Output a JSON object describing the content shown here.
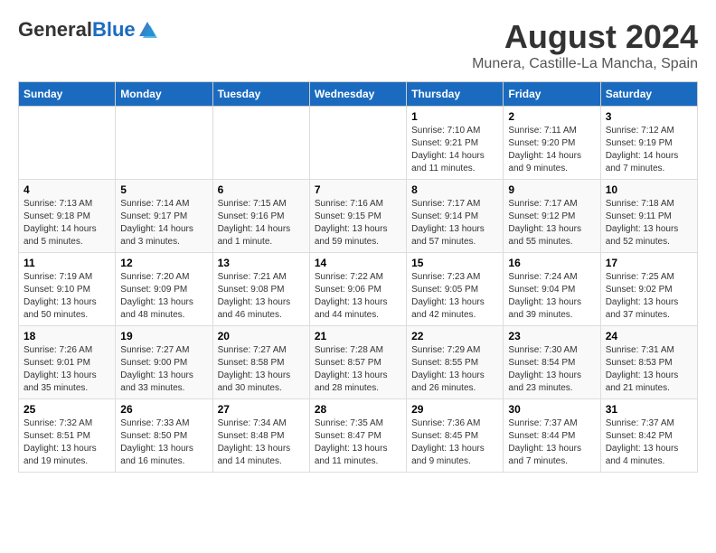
{
  "header": {
    "logo_general": "General",
    "logo_blue": "Blue",
    "main_title": "August 2024",
    "subtitle": "Munera, Castille-La Mancha, Spain"
  },
  "calendar": {
    "days_of_week": [
      "Sunday",
      "Monday",
      "Tuesday",
      "Wednesday",
      "Thursday",
      "Friday",
      "Saturday"
    ],
    "weeks": [
      [
        {
          "day": "",
          "info": ""
        },
        {
          "day": "",
          "info": ""
        },
        {
          "day": "",
          "info": ""
        },
        {
          "day": "",
          "info": ""
        },
        {
          "day": "1",
          "info": "Sunrise: 7:10 AM\nSunset: 9:21 PM\nDaylight: 14 hours\nand 11 minutes."
        },
        {
          "day": "2",
          "info": "Sunrise: 7:11 AM\nSunset: 9:20 PM\nDaylight: 14 hours\nand 9 minutes."
        },
        {
          "day": "3",
          "info": "Sunrise: 7:12 AM\nSunset: 9:19 PM\nDaylight: 14 hours\nand 7 minutes."
        }
      ],
      [
        {
          "day": "4",
          "info": "Sunrise: 7:13 AM\nSunset: 9:18 PM\nDaylight: 14 hours\nand 5 minutes."
        },
        {
          "day": "5",
          "info": "Sunrise: 7:14 AM\nSunset: 9:17 PM\nDaylight: 14 hours\nand 3 minutes."
        },
        {
          "day": "6",
          "info": "Sunrise: 7:15 AM\nSunset: 9:16 PM\nDaylight: 14 hours\nand 1 minute."
        },
        {
          "day": "7",
          "info": "Sunrise: 7:16 AM\nSunset: 9:15 PM\nDaylight: 13 hours\nand 59 minutes."
        },
        {
          "day": "8",
          "info": "Sunrise: 7:17 AM\nSunset: 9:14 PM\nDaylight: 13 hours\nand 57 minutes."
        },
        {
          "day": "9",
          "info": "Sunrise: 7:17 AM\nSunset: 9:12 PM\nDaylight: 13 hours\nand 55 minutes."
        },
        {
          "day": "10",
          "info": "Sunrise: 7:18 AM\nSunset: 9:11 PM\nDaylight: 13 hours\nand 52 minutes."
        }
      ],
      [
        {
          "day": "11",
          "info": "Sunrise: 7:19 AM\nSunset: 9:10 PM\nDaylight: 13 hours\nand 50 minutes."
        },
        {
          "day": "12",
          "info": "Sunrise: 7:20 AM\nSunset: 9:09 PM\nDaylight: 13 hours\nand 48 minutes."
        },
        {
          "day": "13",
          "info": "Sunrise: 7:21 AM\nSunset: 9:08 PM\nDaylight: 13 hours\nand 46 minutes."
        },
        {
          "day": "14",
          "info": "Sunrise: 7:22 AM\nSunset: 9:06 PM\nDaylight: 13 hours\nand 44 minutes."
        },
        {
          "day": "15",
          "info": "Sunrise: 7:23 AM\nSunset: 9:05 PM\nDaylight: 13 hours\nand 42 minutes."
        },
        {
          "day": "16",
          "info": "Sunrise: 7:24 AM\nSunset: 9:04 PM\nDaylight: 13 hours\nand 39 minutes."
        },
        {
          "day": "17",
          "info": "Sunrise: 7:25 AM\nSunset: 9:02 PM\nDaylight: 13 hours\nand 37 minutes."
        }
      ],
      [
        {
          "day": "18",
          "info": "Sunrise: 7:26 AM\nSunset: 9:01 PM\nDaylight: 13 hours\nand 35 minutes."
        },
        {
          "day": "19",
          "info": "Sunrise: 7:27 AM\nSunset: 9:00 PM\nDaylight: 13 hours\nand 33 minutes."
        },
        {
          "day": "20",
          "info": "Sunrise: 7:27 AM\nSunset: 8:58 PM\nDaylight: 13 hours\nand 30 minutes."
        },
        {
          "day": "21",
          "info": "Sunrise: 7:28 AM\nSunset: 8:57 PM\nDaylight: 13 hours\nand 28 minutes."
        },
        {
          "day": "22",
          "info": "Sunrise: 7:29 AM\nSunset: 8:55 PM\nDaylight: 13 hours\nand 26 minutes."
        },
        {
          "day": "23",
          "info": "Sunrise: 7:30 AM\nSunset: 8:54 PM\nDaylight: 13 hours\nand 23 minutes."
        },
        {
          "day": "24",
          "info": "Sunrise: 7:31 AM\nSunset: 8:53 PM\nDaylight: 13 hours\nand 21 minutes."
        }
      ],
      [
        {
          "day": "25",
          "info": "Sunrise: 7:32 AM\nSunset: 8:51 PM\nDaylight: 13 hours\nand 19 minutes."
        },
        {
          "day": "26",
          "info": "Sunrise: 7:33 AM\nSunset: 8:50 PM\nDaylight: 13 hours\nand 16 minutes."
        },
        {
          "day": "27",
          "info": "Sunrise: 7:34 AM\nSunset: 8:48 PM\nDaylight: 13 hours\nand 14 minutes."
        },
        {
          "day": "28",
          "info": "Sunrise: 7:35 AM\nSunset: 8:47 PM\nDaylight: 13 hours\nand 11 minutes."
        },
        {
          "day": "29",
          "info": "Sunrise: 7:36 AM\nSunset: 8:45 PM\nDaylight: 13 hours\nand 9 minutes."
        },
        {
          "day": "30",
          "info": "Sunrise: 7:37 AM\nSunset: 8:44 PM\nDaylight: 13 hours\nand 7 minutes."
        },
        {
          "day": "31",
          "info": "Sunrise: 7:37 AM\nSunset: 8:42 PM\nDaylight: 13 hours\nand 4 minutes."
        }
      ]
    ]
  }
}
